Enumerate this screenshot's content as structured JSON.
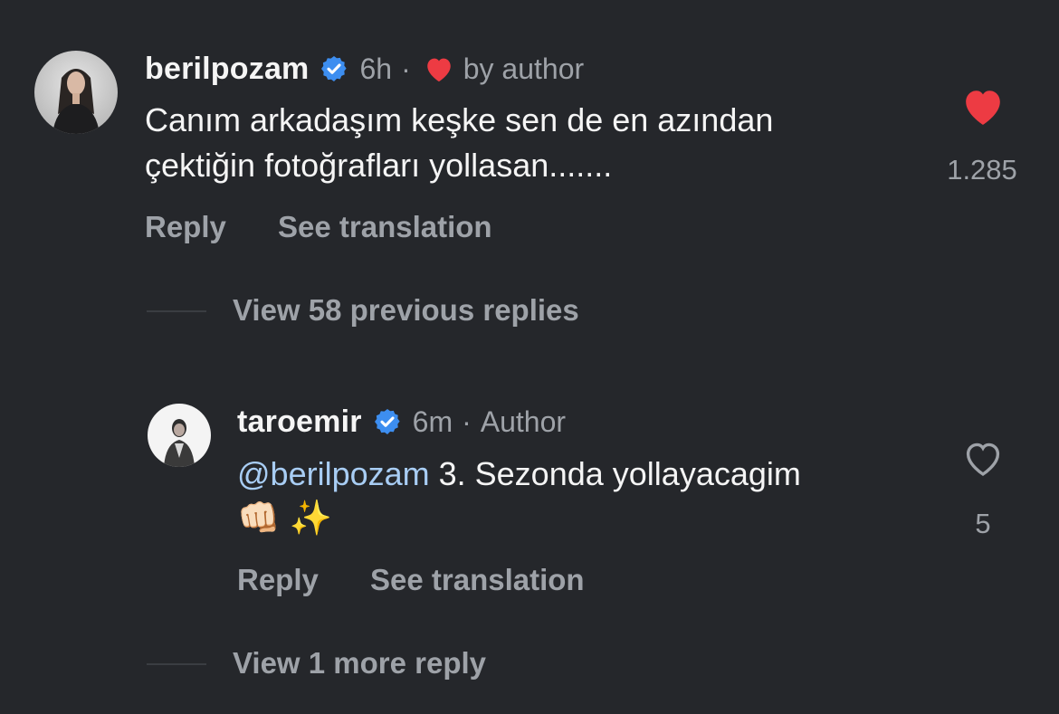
{
  "comment": {
    "username": "berilpozam",
    "verified": true,
    "time": "6h",
    "separator": "·",
    "liked_by_author_label": "by author",
    "text_line1": "Canım arkadaşım keşke sen de en azından",
    "text_line2": "çektiğin fotoğrafları yollasan.......",
    "like_count": "1.285",
    "liked": true,
    "reply_label": "Reply",
    "translate_label": "See translation"
  },
  "view_previous": {
    "label": "View 58 previous replies"
  },
  "reply": {
    "username": "taroemir",
    "verified": true,
    "time": "6m",
    "separator": "·",
    "author_label": "Author",
    "mention": "@berilpozam",
    "text": " 3. Sezonda yollayacagim",
    "emoji": "👊🏻 ✨",
    "like_count": "5",
    "liked": false,
    "reply_label": "Reply",
    "translate_label": "See translation"
  },
  "view_more": {
    "label": "View 1 more reply"
  },
  "colors": {
    "background": "#25272b",
    "like_red": "#ed3b43",
    "verified_blue": "#3d8ef0",
    "mention": "#a8cdf4",
    "secondary_text": "#9ea2a8"
  }
}
